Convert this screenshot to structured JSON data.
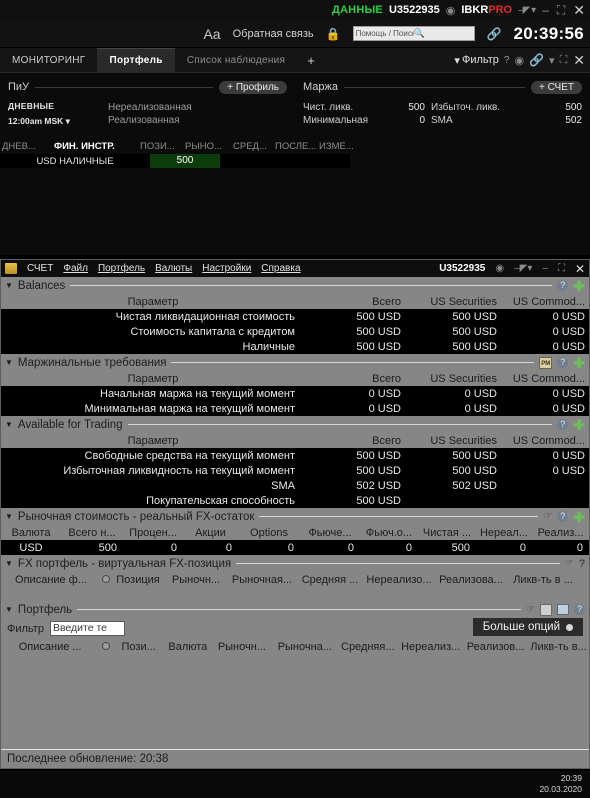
{
  "mosaic": {
    "titlebar": {
      "data_label": "ДАННЫЕ",
      "account": "U3522935",
      "gear_icon": "gear-icon",
      "brand_ibkr": "IBKR",
      "brand_pro": "PRO",
      "pin_icon": "pin-icon",
      "minimize": "–",
      "maximize": "⛶",
      "close": "✕"
    },
    "toolbar": {
      "font_size_icon": "Aa",
      "feedback_label": "Обратная связь",
      "lock_icon": "lock-icon",
      "search_placeholder": "Помощь / Поиск тикера",
      "search_icon": "search-icon",
      "link_icon": "link-icon",
      "clock": "20:39:56"
    },
    "tabs": [
      {
        "label": "МОНИТОРИНГ",
        "active": false
      },
      {
        "label": "Портфель",
        "active": true
      },
      {
        "label": "Список наблюдения",
        "active": false
      },
      {
        "label": "+",
        "active": false
      }
    ],
    "tab_right": {
      "filter_icon": "filter-icon",
      "filter_label": "Фильтр",
      "help_label": "?",
      "gear_icon": "gear-icon",
      "link_icon": "link-icon",
      "caret_icon": "▾",
      "maximize_icon": "⛶",
      "close_icon": "✕"
    },
    "pnl_panel": {
      "title": "ПиУ",
      "add_button": "+ Профиль",
      "period_label": "ДНЕВНЫЕ",
      "period_time": "12:00am MSK",
      "rows": [
        "Нереализованная",
        "Реализованная"
      ]
    },
    "margin_panel": {
      "title": "Маржа",
      "add_button": "+ СЧЕТ",
      "rows": [
        {
          "k1": "Чист. ликв.",
          "v1": "500",
          "k2": "Избыточ. ликв.",
          "v2": "500"
        },
        {
          "k1": "Минимальная",
          "v1": "0",
          "k2": "SMA",
          "v2": "502"
        }
      ]
    },
    "instrument_table": {
      "headers": [
        "ДНЕВ...",
        "ФИН. ИНСТР.",
        "ПОЗИ...",
        "РЫНО...",
        "СРЕД...",
        "ПОСЛЕ...",
        "ИЗМЕ..."
      ],
      "active_header": "ФИН. ИНСТР.",
      "rows": [
        {
          "name": "USD НАЛИЧНЫЕ",
          "value": "500"
        }
      ]
    }
  },
  "account_window": {
    "menubar": {
      "app_icon": "account-icon",
      "app_label": "СЧЕТ",
      "items": [
        "Файл",
        "Портфель",
        "Валюты",
        "Настройки",
        "Справка"
      ],
      "account": "U3522935",
      "gear_icon": "gear-icon",
      "pin_icon": "pin-icon",
      "minimize": "–",
      "maximize": "⛶",
      "close": "✕"
    },
    "balances": {
      "title": "Balances",
      "columns": [
        "Параметр",
        "Всего",
        "US Securities",
        "US Commod..."
      ],
      "rows": [
        {
          "name": "Чистая ликвидационная стоимость",
          "total": "500 USD",
          "sec": "500 USD",
          "com": "0 USD"
        },
        {
          "name": "Стоимость капитала с кредитом",
          "total": "500 USD",
          "sec": "500 USD",
          "com": "0 USD"
        },
        {
          "name": "Наличные",
          "total": "500 USD",
          "sec": "500 USD",
          "com": "0 USD"
        }
      ]
    },
    "margin_requirements": {
      "title": "Маржинальные требования",
      "columns": [
        "Параметр",
        "Всего",
        "US Securities",
        "US Commod..."
      ],
      "rows": [
        {
          "name": "Начальная маржа на текущий момент",
          "total": "0 USD",
          "sec": "0 USD",
          "com": "0 USD"
        },
        {
          "name": "Минимальная маржа на текущий момент",
          "total": "0 USD",
          "sec": "0 USD",
          "com": "0 USD"
        }
      ]
    },
    "available_for_trading": {
      "title": "Available for Trading",
      "columns": [
        "Параметр",
        "Всего",
        "US Securities",
        "US Commod..."
      ],
      "rows": [
        {
          "name": "Свободные средства на текущий момент",
          "total": "500 USD",
          "sec": "500 USD",
          "com": "0 USD"
        },
        {
          "name": "Избыточная ликвидность на текущий момент",
          "total": "500 USD",
          "sec": "500 USD",
          "com": "0 USD"
        },
        {
          "name": "SMA",
          "total": "502 USD",
          "sec": "502 USD",
          "com": ""
        },
        {
          "name": "Покупательская способность",
          "total": "500 USD",
          "sec": "",
          "com": ""
        }
      ]
    },
    "market_value": {
      "title": "Рыночная стоимость - реальный FX-остаток",
      "columns": [
        "Валюта",
        "Всего н...",
        "Процен...",
        "Акции",
        "Options",
        "Фьюче...",
        "Фьюч.о...",
        "Чистая ...",
        "Нереал...",
        "Реализ..."
      ],
      "rows": [
        {
          "cells": [
            "USD",
            "500",
            "0",
            "0",
            "0",
            "0",
            "0",
            "500",
            "0",
            "0"
          ]
        }
      ]
    },
    "fx_portfolio": {
      "title": "FX портфель - виртуальная FX-позиция",
      "help_label": "?",
      "columns": [
        "Описание ф...",
        "Позиция",
        "Рыночн...",
        "Рыночная...",
        "Средняя ...",
        "Нереализо...",
        "Реализова...",
        "Ликв-ть в ..."
      ]
    },
    "portfolio": {
      "title": "Портфель",
      "filter_label": "Фильтр",
      "filter_placeholder": "Введите те",
      "more_options_label": "Больше опций",
      "columns": [
        "Описание ...",
        "Пози...",
        "Валюта",
        "Рыночн...",
        "Рыночна...",
        "Средняя...",
        "Нереализ...",
        "Реализов...",
        "Ликв-ть в..."
      ]
    },
    "status": {
      "last_update_label": "Последнее обновление:",
      "last_update_time": "20:38"
    }
  },
  "desktop": {
    "tray_time": "20:39",
    "tray_date": "20.03.2020"
  }
}
